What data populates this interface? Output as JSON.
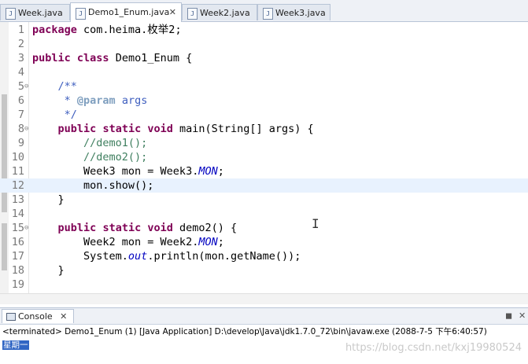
{
  "tabs": [
    {
      "label": "Week.java"
    },
    {
      "label": "Demo1_Enum.java",
      "close": "✕"
    },
    {
      "label": "Week2.java"
    },
    {
      "label": "Week3.java"
    }
  ],
  "editor": {
    "lines": [
      {
        "n": "1",
        "segs": [
          {
            "t": "package",
            "c": "kw"
          },
          {
            "t": " com.heima.枚举2;"
          }
        ]
      },
      {
        "n": "2",
        "segs": []
      },
      {
        "n": "3",
        "segs": [
          {
            "t": "public",
            "c": "kw"
          },
          {
            "t": " "
          },
          {
            "t": "class",
            "c": "kw"
          },
          {
            "t": " Demo1_Enum {"
          }
        ]
      },
      {
        "n": "4",
        "segs": []
      },
      {
        "n": "5",
        "fold": "⊖",
        "segs": [
          {
            "t": "    /**",
            "c": "jd"
          }
        ]
      },
      {
        "n": "6",
        "segs": [
          {
            "t": "     * ",
            "c": "jd"
          },
          {
            "t": "@param",
            "c": "tag"
          },
          {
            "t": " args",
            "c": "jd"
          }
        ]
      },
      {
        "n": "7",
        "segs": [
          {
            "t": "     */",
            "c": "jd"
          }
        ]
      },
      {
        "n": "8",
        "fold": "⊖",
        "segs": [
          {
            "t": "    "
          },
          {
            "t": "public",
            "c": "kw"
          },
          {
            "t": " "
          },
          {
            "t": "static",
            "c": "kw"
          },
          {
            "t": " "
          },
          {
            "t": "void",
            "c": "kw"
          },
          {
            "t": " main(String[] args) {"
          }
        ]
      },
      {
        "n": "9",
        "segs": [
          {
            "t": "        "
          },
          {
            "t": "//demo1();",
            "c": "cm"
          }
        ]
      },
      {
        "n": "10",
        "segs": [
          {
            "t": "        "
          },
          {
            "t": "//demo2();",
            "c": "cm"
          }
        ]
      },
      {
        "n": "11",
        "segs": [
          {
            "t": "        Week3 mon = Week3."
          },
          {
            "t": "MON",
            "c": "st"
          },
          {
            "t": ";"
          }
        ]
      },
      {
        "n": "12",
        "current": true,
        "segs": [
          {
            "t": "        mon.show();"
          }
        ]
      },
      {
        "n": "13",
        "segs": [
          {
            "t": "    }"
          }
        ]
      },
      {
        "n": "14",
        "segs": []
      },
      {
        "n": "15",
        "fold": "⊖",
        "segs": [
          {
            "t": "    "
          },
          {
            "t": "public",
            "c": "kw"
          },
          {
            "t": " "
          },
          {
            "t": "static",
            "c": "kw"
          },
          {
            "t": " "
          },
          {
            "t": "void",
            "c": "kw"
          },
          {
            "t": " demo2() {"
          }
        ]
      },
      {
        "n": "16",
        "segs": [
          {
            "t": "        Week2 mon = Week2."
          },
          {
            "t": "MON",
            "c": "st"
          },
          {
            "t": ";"
          }
        ]
      },
      {
        "n": "17",
        "segs": [
          {
            "t": "        System."
          },
          {
            "t": "out",
            "c": "st"
          },
          {
            "t": ".println(mon.getName());"
          }
        ]
      },
      {
        "n": "18",
        "segs": [
          {
            "t": "    }"
          }
        ]
      },
      {
        "n": "19",
        "segs": []
      }
    ]
  },
  "console": {
    "title": "Console",
    "close": "✕",
    "controls": [
      "◼",
      "✕"
    ],
    "status": "<terminated> Demo1_Enum (1) [Java Application] D:\\develop\\Java\\jdk1.7.0_72\\bin\\javaw.exe (2088-7-5 下午6:40:57)",
    "output": "星期一"
  },
  "watermark": "https://blog.csdn.net/kxj19980524"
}
